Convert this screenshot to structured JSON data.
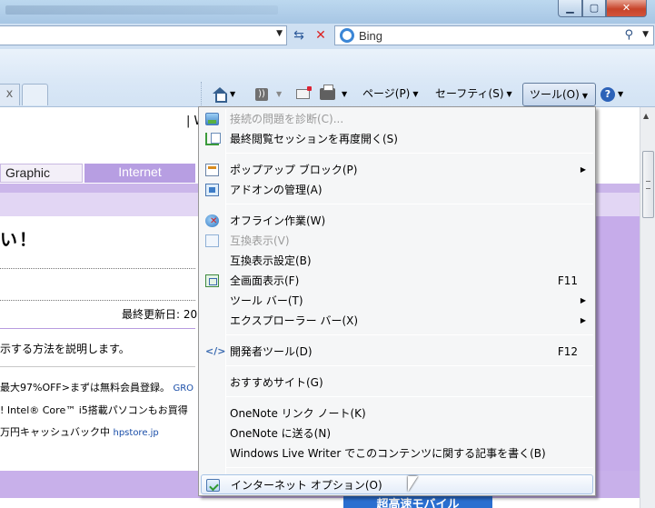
{
  "titlebar": {
    "title": "",
    "min_glyph": "▁",
    "max_glyph": "▢",
    "close_glyph": "✕"
  },
  "address": {
    "dropdown_glyph": "▼",
    "refresh_glyph": "⇆",
    "stop_glyph": "✕"
  },
  "search": {
    "placeholder": "Bing",
    "search_glyph": "⚲",
    "dropdown_glyph": "▼"
  },
  "tabs": {
    "close_glyph": "x"
  },
  "commandbar": {
    "feed_glyph": "))",
    "page_label": "ページ(P)",
    "safety_label": "セーフティ(S)",
    "tools_label": "ツール(O)",
    "help_glyph": "?",
    "arrow": "▼"
  },
  "page": {
    "w_fragment": "| W",
    "nav_graphic": "Graphic",
    "nav_internet": "Internet",
    "heading": "い！",
    "updated": "最終更新日: 20",
    "description": "示する方法を説明します。",
    "ad1_text": "最大97%OFF>まずは無料会員登録。",
    "ad1_link": "GRO",
    "ad2_text": "! Intel® Core™ i5搭載パソコンもお買得",
    "ad3_text": "万円キャッシュバック中 ",
    "ad3_link": "hpstore.jp",
    "banner": "超高速モバイル"
  },
  "menu": {
    "submenu_arrow": "▶",
    "items": [
      {
        "label": "接続の問題を診断(C)...",
        "shortcut": "",
        "disabled": true,
        "icon": "diagnose-icon"
      },
      {
        "label": "最終閲覧セッションを再度開く(S)",
        "shortcut": "",
        "disabled": false,
        "icon": "reopen-session-icon"
      },
      {
        "label": "ポップアップ ブロック(P)",
        "shortcut": "",
        "disabled": false,
        "icon": "popup-blocker-icon",
        "submenu": true
      },
      {
        "label": "アドオンの管理(A)",
        "shortcut": "",
        "disabled": false,
        "icon": "addons-icon"
      },
      {
        "label": "オフライン作業(W)",
        "shortcut": "",
        "disabled": false,
        "icon": "offline-icon"
      },
      {
        "label": "互換表示(V)",
        "shortcut": "",
        "disabled": true,
        "icon": "compatibility-icon"
      },
      {
        "label": "互換表示設定(B)",
        "shortcut": "",
        "disabled": false
      },
      {
        "label": "全画面表示(F)",
        "shortcut": "F11",
        "disabled": false,
        "icon": "fullscreen-icon"
      },
      {
        "label": "ツール バー(T)",
        "shortcut": "",
        "disabled": false,
        "submenu": true
      },
      {
        "label": "エクスプローラー バー(X)",
        "shortcut": "",
        "disabled": false,
        "submenu": true
      },
      {
        "label": "開発者ツール(D)",
        "shortcut": "F12",
        "disabled": false,
        "icon": "developer-tools-icon"
      },
      {
        "label": "おすすめサイト(G)",
        "shortcut": "",
        "disabled": false
      },
      {
        "label": "OneNote リンク ノート(K)",
        "shortcut": "",
        "disabled": false
      },
      {
        "label": "OneNote に送る(N)",
        "shortcut": "",
        "disabled": false
      },
      {
        "label": "Windows Live Writer でこのコンテンツに関する記事を書く(B)",
        "shortcut": "",
        "disabled": false
      },
      {
        "label": "インターネット オプション(O)",
        "shortcut": "",
        "disabled": false,
        "icon": "internet-options-icon",
        "highlighted": true
      }
    ]
  },
  "colors": {
    "nav_active": "#b79ee2",
    "band": "#cbb6ea",
    "menu_bg": "#f5f6f7",
    "highlight_border": "#a8c4e6"
  }
}
